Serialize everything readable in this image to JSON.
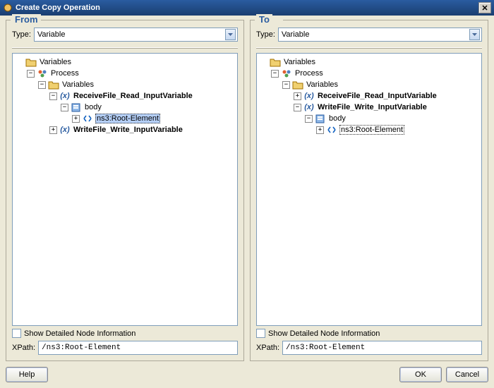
{
  "window": {
    "title": "Create Copy Operation"
  },
  "from": {
    "heading": "From",
    "type_label": "Type:",
    "type_value": "Variable",
    "tree": {
      "root": "Variables",
      "process": "Process",
      "variables": "Variables",
      "receive": "ReceiveFile_Read_InputVariable",
      "body": "body",
      "root_elem": "ns3:Root-Element",
      "write": "WriteFile_Write_InputVariable"
    },
    "show_detail": "Show Detailed Node Information",
    "xpath_label": "XPath:",
    "xpath_value": "/ns3:Root-Element"
  },
  "to": {
    "heading": "To",
    "type_label": "Type:",
    "type_value": "Variable",
    "tree": {
      "root": "Variables",
      "process": "Process",
      "variables": "Variables",
      "receive": "ReceiveFile_Read_InputVariable",
      "write": "WriteFile_Write_InputVariable",
      "body": "body",
      "root_elem": "ns3:Root-Element"
    },
    "show_detail": "Show Detailed Node Information",
    "xpath_label": "XPath:",
    "xpath_value": "/ns3:Root-Element"
  },
  "buttons": {
    "help": "Help",
    "ok": "OK",
    "cancel": "Cancel"
  }
}
